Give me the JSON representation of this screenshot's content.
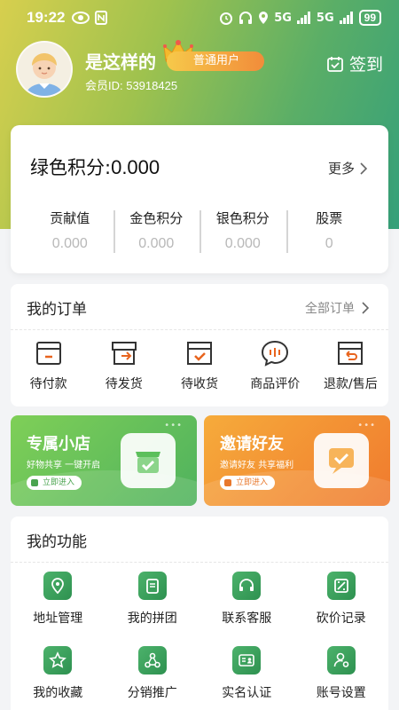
{
  "status_bar": {
    "time": "19:22",
    "network": "5G",
    "network2": "5G",
    "battery": "99"
  },
  "profile": {
    "username": "是这样的",
    "level": "普通用户",
    "member_id": "会员ID: 53918425",
    "signin_label": "签到"
  },
  "points": {
    "title": "绿色积分:",
    "value": "0.000",
    "more_label": "更多",
    "stats": [
      {
        "label": "贡献值",
        "value": "0.000"
      },
      {
        "label": "金色积分",
        "value": "0.000"
      },
      {
        "label": "银色积分",
        "value": "0.000"
      },
      {
        "label": "股票",
        "value": "0"
      }
    ]
  },
  "orders": {
    "title": "我的订单",
    "all_label": "全部订单",
    "items": [
      {
        "label": "待付款",
        "icon": "wallet-icon"
      },
      {
        "label": "待发货",
        "icon": "box-out-icon"
      },
      {
        "label": "待收货",
        "icon": "box-check-icon"
      },
      {
        "label": "商品评价",
        "icon": "chat-bubble-icon"
      },
      {
        "label": "退款/售后",
        "icon": "box-return-icon"
      }
    ]
  },
  "banners": [
    {
      "title": "专属小店",
      "subtitle": "好物共享 一键开启",
      "button": "立即进入",
      "icon": "shop-icon"
    },
    {
      "title": "邀请好友",
      "subtitle": "邀请好友 共享福利",
      "button": "立即进入",
      "icon": "invite-icon"
    }
  ],
  "functions": {
    "title": "我的功能",
    "items": [
      {
        "label": "地址管理",
        "icon": "location-icon"
      },
      {
        "label": "我的拼团",
        "icon": "group-buy-icon"
      },
      {
        "label": "联系客服",
        "icon": "headset-icon"
      },
      {
        "label": "砍价记录",
        "icon": "bargain-icon"
      },
      {
        "label": "我的收藏",
        "icon": "star-icon"
      },
      {
        "label": "分销推广",
        "icon": "share-icon"
      },
      {
        "label": "实名认证",
        "icon": "id-card-icon"
      },
      {
        "label": "账号设置",
        "icon": "account-settings-icon"
      }
    ]
  },
  "colors": {
    "accent_green": "#3aa75a",
    "badge_orange": "#f28c3a",
    "banner_green": "#5cba5a",
    "banner_orange": "#f28a33",
    "order_icon_orange": "#e8641e"
  }
}
